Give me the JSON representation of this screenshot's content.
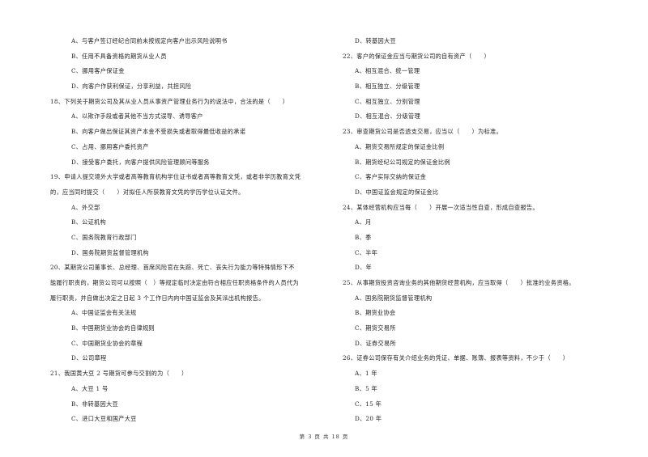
{
  "left_column": [
    {
      "type": "opt",
      "text": "A、与客户签订经纪合同前未按规定向客户出示风险说明书"
    },
    {
      "type": "opt",
      "text": "B、任用不具备资格的期货从业人员"
    },
    {
      "type": "opt",
      "text": "C、挪用客户保证金"
    },
    {
      "type": "opt",
      "text": "D、向客户作获利保证，分享利益，共担风险"
    },
    {
      "type": "q",
      "text": "18、下列关于期货公司及其从业人员从事资产管理业务行为的说法中，合法的是（　　）"
    },
    {
      "type": "opt",
      "text": "A、以欺诈手段或者其他不当方式误导、诱导客户"
    },
    {
      "type": "opt",
      "text": "B、向客户做出保证其资产本金不受损失或者取得最低收益的承诺"
    },
    {
      "type": "opt",
      "text": "C、占用、挪用客户委托资产"
    },
    {
      "type": "opt",
      "text": "D、接受客户委托，向客户提供风险管理顾问等服务"
    },
    {
      "type": "q",
      "text": "19、申请人提交境外大学或者高等教育机构学位证书或者高等教育文凭，或者非学历教育文凭"
    },
    {
      "type": "q",
      "text": "的，应当同时提交（　　）对拟任人所获教育文凭的学历学位认证文件。"
    },
    {
      "type": "opt",
      "text": "A、外交部"
    },
    {
      "type": "opt",
      "text": "B、公证机构"
    },
    {
      "type": "opt",
      "text": "C、国务院教育行政部门"
    },
    {
      "type": "opt",
      "text": "D、国务院期货监督管理机构"
    },
    {
      "type": "q",
      "text": "20、某期货公司董事长、总经理、首席风险官在失踪、死亡、丧失行为能力等特殊情形下不"
    },
    {
      "type": "q",
      "text": "能履行职责的，期货公司可以按照（　）等规定临时决定由符合相应任职资格条件的人员代为"
    },
    {
      "type": "q",
      "text": "履行职责，并自做出决定之日起 3 个工作日内向中国证监会及其派出机构报告。"
    },
    {
      "type": "opt",
      "text": "A、中国证监会有关法规"
    },
    {
      "type": "opt",
      "text": "B、中国期货业协会的自律规则"
    },
    {
      "type": "opt",
      "text": "C、中国期货业协会的章程"
    },
    {
      "type": "opt",
      "text": "D、公司章程"
    },
    {
      "type": "q",
      "text": "21、我国黄大豆 2 号期货可参与交割的为（　　）"
    },
    {
      "type": "opt",
      "text": "A、大豆 1 号"
    },
    {
      "type": "opt",
      "text": "B、非转基因大豆"
    },
    {
      "type": "opt",
      "text": "C、进口大豆和国产大豆"
    }
  ],
  "right_column": [
    {
      "type": "opt",
      "text": "D、转基因大豆"
    },
    {
      "type": "q",
      "text": "22、客户的保证金应当与期货公司的自有资产（　　）"
    },
    {
      "type": "opt",
      "text": "A、相互混合、统一管理"
    },
    {
      "type": "opt",
      "text": "B、相互独立、分级管理"
    },
    {
      "type": "opt",
      "text": "C、相互独立、分别管理"
    },
    {
      "type": "opt",
      "text": "D、相互混合、分级管理"
    },
    {
      "type": "q",
      "text": "23、审查期货公司是否透支交易，应当以（　　）为标准。"
    },
    {
      "type": "opt",
      "text": "A、期货交易所规定的保证金比例"
    },
    {
      "type": "opt",
      "text": "B、期货经纪公司规定的保证金比例"
    },
    {
      "type": "opt",
      "text": "C、客户实际交纳的保证金"
    },
    {
      "type": "opt",
      "text": "D、中国证监会规定的保证金比"
    },
    {
      "type": "q",
      "text": "24、某体经营机构应当每（　　）开展一次适当性自查，形成自查报告。"
    },
    {
      "type": "opt",
      "text": "A、月"
    },
    {
      "type": "opt",
      "text": "B、季"
    },
    {
      "type": "opt",
      "text": "C、半年"
    },
    {
      "type": "opt",
      "text": "D、年"
    },
    {
      "type": "q",
      "text": "25、从事期货投资咨询业务的其他期货经营机构，应当取得（　　）批准的业务资格。"
    },
    {
      "type": "opt",
      "text": "A、国务院期货监督管理机构"
    },
    {
      "type": "opt",
      "text": "B、期货业协会"
    },
    {
      "type": "opt",
      "text": "C、期货交易所"
    },
    {
      "type": "opt",
      "text": "D、证券交易所"
    },
    {
      "type": "q",
      "text": "26、证券公司保存有关介绍业务的凭证、单据、账簿、报表等资料，不少于（　　）"
    },
    {
      "type": "opt",
      "text": "A、1 年"
    },
    {
      "type": "opt",
      "text": "B、5 年"
    },
    {
      "type": "opt",
      "text": "C、15 年"
    },
    {
      "type": "opt",
      "text": "D、20 年"
    }
  ],
  "footer": {
    "page_label": "第 3 页 共 18 页"
  }
}
